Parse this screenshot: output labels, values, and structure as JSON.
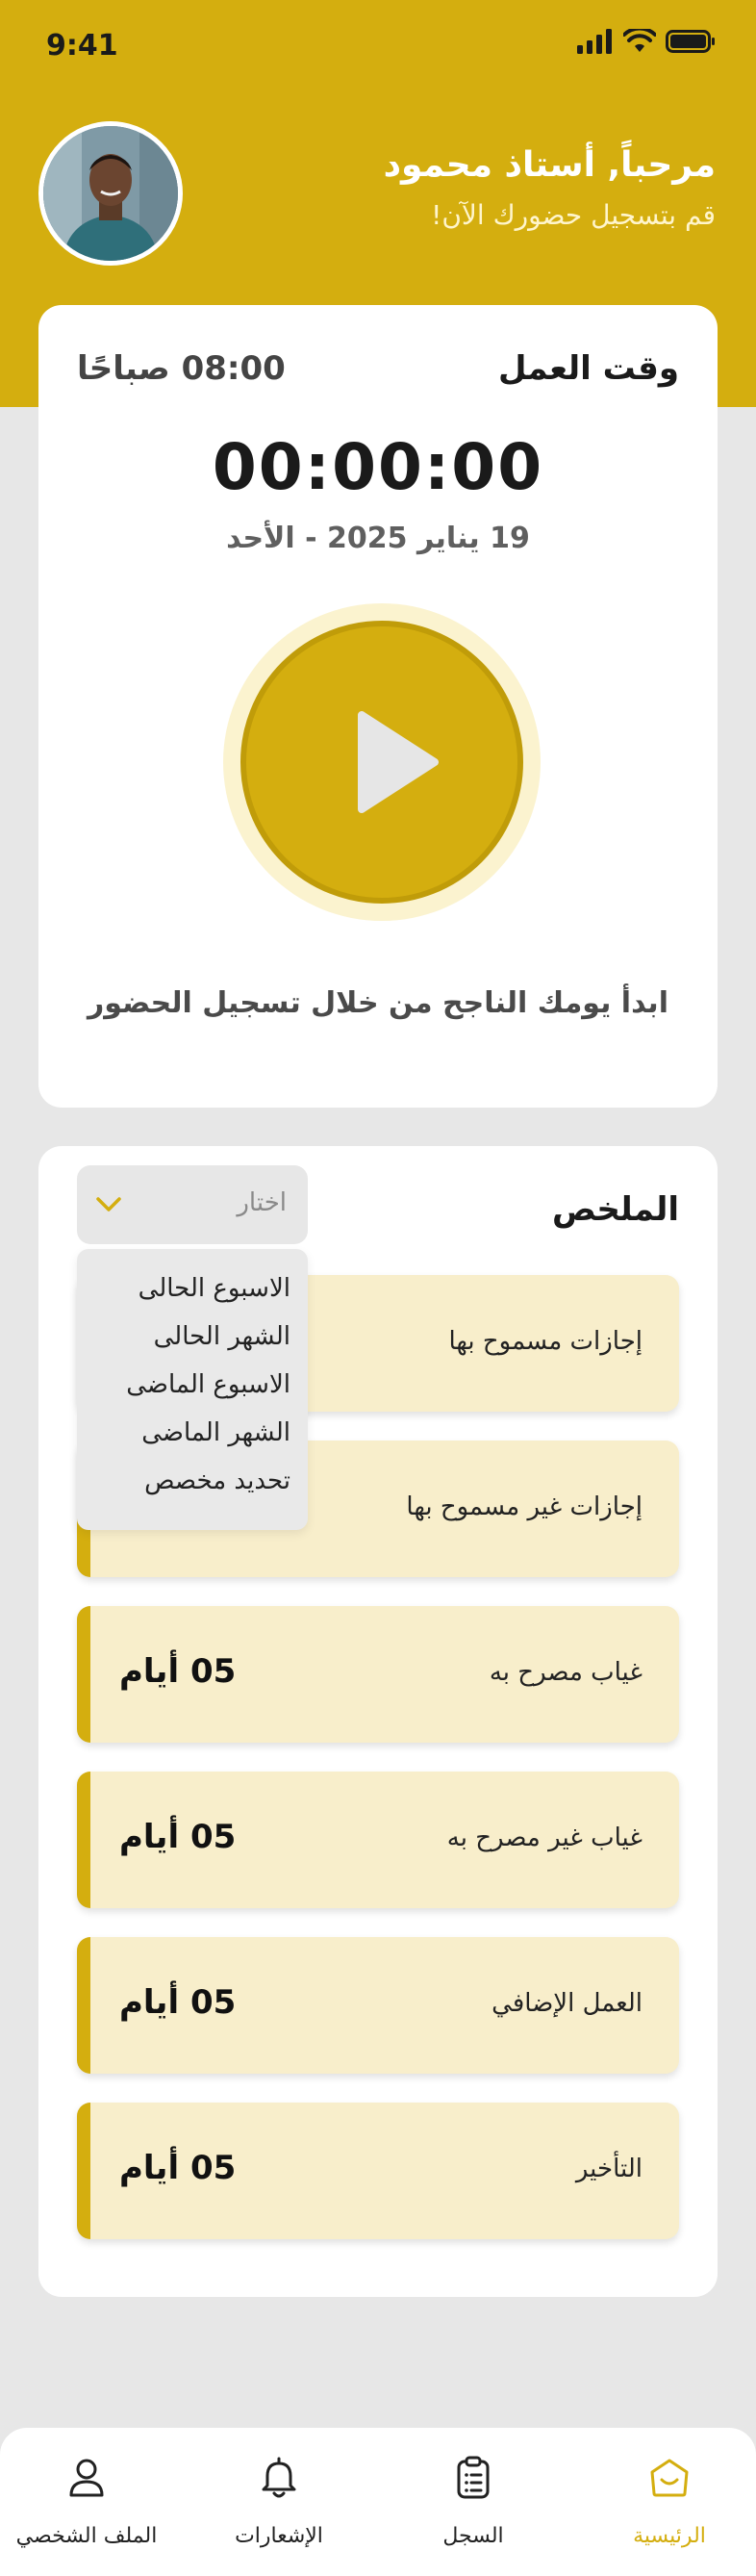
{
  "status_bar": {
    "time": "9:41"
  },
  "header": {
    "greeting": "مرحباً, أستاذ محمود",
    "subtitle": "قم بتسجيل حضورك الآن!"
  },
  "work_card": {
    "title": "وقت العمل",
    "start_time": "08:00 صباحًا",
    "timer": "00:00:00",
    "date": "19 يناير 2025 - الأحد",
    "hint": "ابدأ يومك الناجح من خلال تسجيل الحضور"
  },
  "summary": {
    "title": "الملخص",
    "select_placeholder": "اختار",
    "dropdown_options": [
      "الاسبوع الحالى",
      "الشهر الحالى",
      "الاسبوع الماضى",
      "الشهر الماضى",
      "تحديد مخصص"
    ],
    "items": [
      {
        "label": "إجازات مسموح بها",
        "value": ""
      },
      {
        "label": "إجازات غير مسموح بها",
        "value": ""
      },
      {
        "label": "غياب مصرح به",
        "value": "05 أيام"
      },
      {
        "label": "غياب غير مصرح به",
        "value": "05 أيام"
      },
      {
        "label": "العمل الإضافي",
        "value": "05 أيام"
      },
      {
        "label": "التأخير",
        "value": "05 أيام"
      }
    ]
  },
  "nav": {
    "home": "الرئيسية",
    "log": "السجل",
    "notifications": "الإشعارات",
    "profile": "الملف الشخصي"
  },
  "colors": {
    "accent": "#d4ae0f",
    "card_bg": "#f8eecb",
    "page_bg": "#e7e7e7"
  }
}
